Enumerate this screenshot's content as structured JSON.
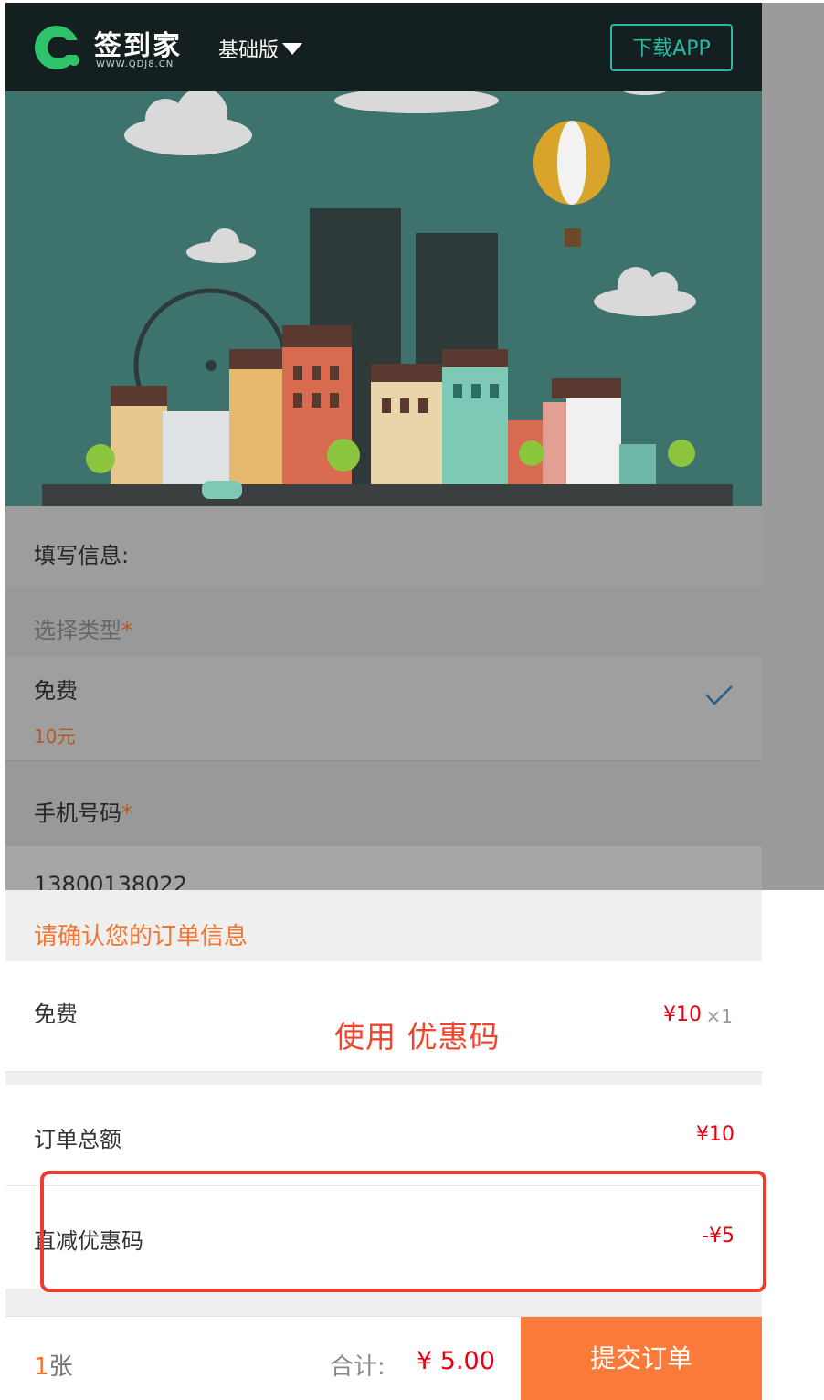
{
  "header": {
    "logo_text": "签到家",
    "logo_sub": "WWW.QDJ8.CN",
    "edition": "基础版",
    "download_button": "下载APP"
  },
  "form": {
    "title": "填写信息:",
    "type_label": "选择类型",
    "required_mark": "*",
    "option": {
      "name": "免费",
      "price": "10元",
      "selected": true
    },
    "phone_label": "手机号码",
    "phone_value": "13800138022"
  },
  "order": {
    "confirm_title": "请确认您的订单信息",
    "item_name": "免费",
    "item_price": "¥10",
    "item_qty": "×1",
    "coupon_note": "使用 优惠码",
    "total_label": "订单总额",
    "total_value": "¥10",
    "discount_label": "直减优惠码",
    "discount_value": "-¥5"
  },
  "footer": {
    "count_number": "1",
    "count_unit": "张",
    "sum_label": "合计:",
    "sum_value": "¥ 5.00",
    "submit_label": "提交订单"
  },
  "colors": {
    "accent": "#f97a39",
    "price_red": "#e60012",
    "brand_green": "#2bb9a6",
    "highlight": "#ee3d2f"
  }
}
